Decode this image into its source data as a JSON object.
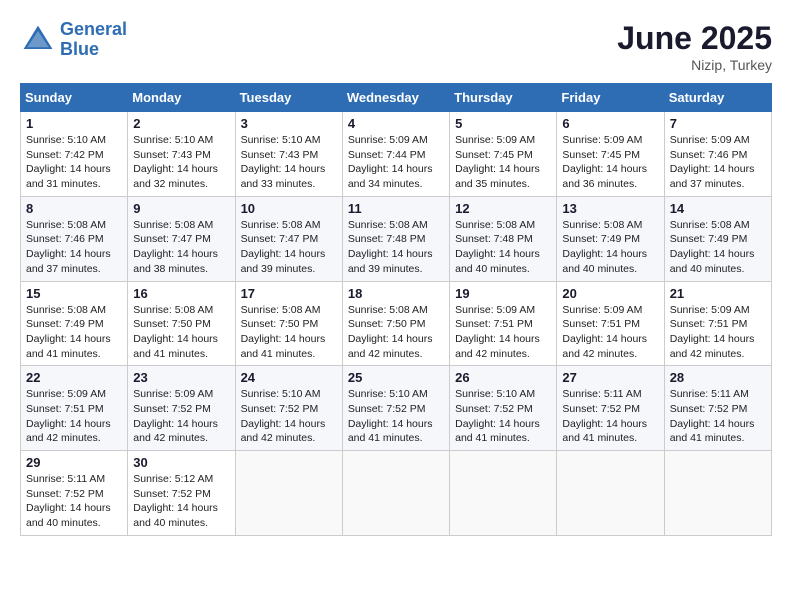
{
  "header": {
    "logo_line1": "General",
    "logo_line2": "Blue",
    "month": "June 2025",
    "location": "Nizip, Turkey"
  },
  "weekdays": [
    "Sunday",
    "Monday",
    "Tuesday",
    "Wednesday",
    "Thursday",
    "Friday",
    "Saturday"
  ],
  "weeks": [
    [
      {
        "day": "1",
        "sunrise": "5:10 AM",
        "sunset": "7:42 PM",
        "daylight": "14 hours and 31 minutes."
      },
      {
        "day": "2",
        "sunrise": "5:10 AM",
        "sunset": "7:43 PM",
        "daylight": "14 hours and 32 minutes."
      },
      {
        "day": "3",
        "sunrise": "5:10 AM",
        "sunset": "7:43 PM",
        "daylight": "14 hours and 33 minutes."
      },
      {
        "day": "4",
        "sunrise": "5:09 AM",
        "sunset": "7:44 PM",
        "daylight": "14 hours and 34 minutes."
      },
      {
        "day": "5",
        "sunrise": "5:09 AM",
        "sunset": "7:45 PM",
        "daylight": "14 hours and 35 minutes."
      },
      {
        "day": "6",
        "sunrise": "5:09 AM",
        "sunset": "7:45 PM",
        "daylight": "14 hours and 36 minutes."
      },
      {
        "day": "7",
        "sunrise": "5:09 AM",
        "sunset": "7:46 PM",
        "daylight": "14 hours and 37 minutes."
      }
    ],
    [
      {
        "day": "8",
        "sunrise": "5:08 AM",
        "sunset": "7:46 PM",
        "daylight": "14 hours and 37 minutes."
      },
      {
        "day": "9",
        "sunrise": "5:08 AM",
        "sunset": "7:47 PM",
        "daylight": "14 hours and 38 minutes."
      },
      {
        "day": "10",
        "sunrise": "5:08 AM",
        "sunset": "7:47 PM",
        "daylight": "14 hours and 39 minutes."
      },
      {
        "day": "11",
        "sunrise": "5:08 AM",
        "sunset": "7:48 PM",
        "daylight": "14 hours and 39 minutes."
      },
      {
        "day": "12",
        "sunrise": "5:08 AM",
        "sunset": "7:48 PM",
        "daylight": "14 hours and 40 minutes."
      },
      {
        "day": "13",
        "sunrise": "5:08 AM",
        "sunset": "7:49 PM",
        "daylight": "14 hours and 40 minutes."
      },
      {
        "day": "14",
        "sunrise": "5:08 AM",
        "sunset": "7:49 PM",
        "daylight": "14 hours and 40 minutes."
      }
    ],
    [
      {
        "day": "15",
        "sunrise": "5:08 AM",
        "sunset": "7:49 PM",
        "daylight": "14 hours and 41 minutes."
      },
      {
        "day": "16",
        "sunrise": "5:08 AM",
        "sunset": "7:50 PM",
        "daylight": "14 hours and 41 minutes."
      },
      {
        "day": "17",
        "sunrise": "5:08 AM",
        "sunset": "7:50 PM",
        "daylight": "14 hours and 41 minutes."
      },
      {
        "day": "18",
        "sunrise": "5:08 AM",
        "sunset": "7:50 PM",
        "daylight": "14 hours and 42 minutes."
      },
      {
        "day": "19",
        "sunrise": "5:09 AM",
        "sunset": "7:51 PM",
        "daylight": "14 hours and 42 minutes."
      },
      {
        "day": "20",
        "sunrise": "5:09 AM",
        "sunset": "7:51 PM",
        "daylight": "14 hours and 42 minutes."
      },
      {
        "day": "21",
        "sunrise": "5:09 AM",
        "sunset": "7:51 PM",
        "daylight": "14 hours and 42 minutes."
      }
    ],
    [
      {
        "day": "22",
        "sunrise": "5:09 AM",
        "sunset": "7:51 PM",
        "daylight": "14 hours and 42 minutes."
      },
      {
        "day": "23",
        "sunrise": "5:09 AM",
        "sunset": "7:52 PM",
        "daylight": "14 hours and 42 minutes."
      },
      {
        "day": "24",
        "sunrise": "5:10 AM",
        "sunset": "7:52 PM",
        "daylight": "14 hours and 42 minutes."
      },
      {
        "day": "25",
        "sunrise": "5:10 AM",
        "sunset": "7:52 PM",
        "daylight": "14 hours and 41 minutes."
      },
      {
        "day": "26",
        "sunrise": "5:10 AM",
        "sunset": "7:52 PM",
        "daylight": "14 hours and 41 minutes."
      },
      {
        "day": "27",
        "sunrise": "5:11 AM",
        "sunset": "7:52 PM",
        "daylight": "14 hours and 41 minutes."
      },
      {
        "day": "28",
        "sunrise": "5:11 AM",
        "sunset": "7:52 PM",
        "daylight": "14 hours and 41 minutes."
      }
    ],
    [
      {
        "day": "29",
        "sunrise": "5:11 AM",
        "sunset": "7:52 PM",
        "daylight": "14 hours and 40 minutes."
      },
      {
        "day": "30",
        "sunrise": "5:12 AM",
        "sunset": "7:52 PM",
        "daylight": "14 hours and 40 minutes."
      },
      null,
      null,
      null,
      null,
      null
    ]
  ]
}
